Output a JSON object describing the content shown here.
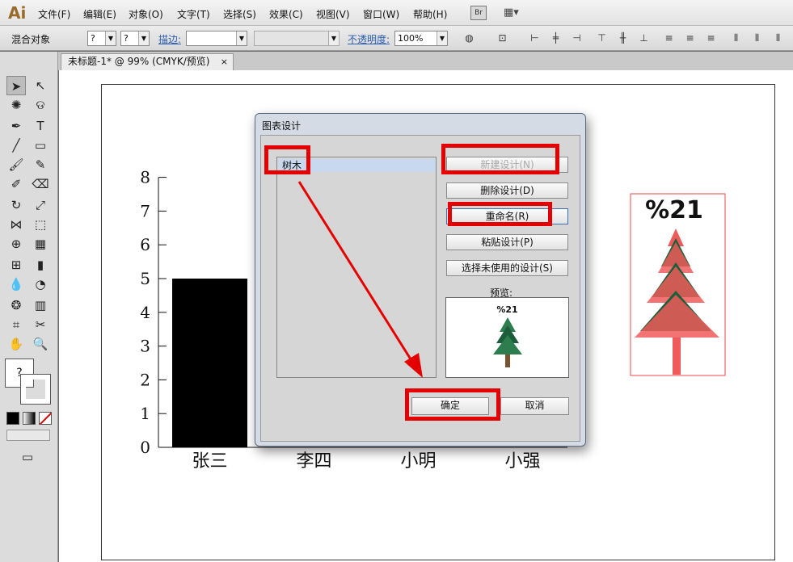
{
  "app": {
    "logo": "Ai"
  },
  "menubar": {
    "items": [
      "文件(F)",
      "编辑(E)",
      "对象(O)",
      "文字(T)",
      "选择(S)",
      "效果(C)",
      "视图(V)",
      "窗口(W)",
      "帮助(H)"
    ],
    "bridge_label": "Br"
  },
  "control_bar": {
    "selection_label": "混合对象",
    "fill_value": "?",
    "stroke_value": "?",
    "stroke_link": "描边:",
    "opacity_link": "不透明度:",
    "opacity_value": "100%"
  },
  "document_tab": {
    "title": "未标题-1* @ 99% (CMYK/预览)",
    "close_symbol": "×"
  },
  "toolbox": {
    "fill_stroke_question": "?"
  },
  "colors": {
    "highlight": "#e50000",
    "tree_pink": "#ef5a5a",
    "tree_dark": "#1d5e3a",
    "tree_green": "#2e7d4f",
    "trunk": "#7a5230"
  },
  "chart_data": {
    "type": "bar",
    "categories": [
      "张三",
      "李四",
      "小明",
      "小强"
    ],
    "values": [
      5,
      null,
      null,
      null
    ],
    "ylim": [
      0,
      8
    ],
    "yticks": [
      "0",
      "1",
      "2",
      "3",
      "4",
      "5",
      "6",
      "7",
      "8"
    ]
  },
  "artboard_object": {
    "label": "%21"
  },
  "dialog": {
    "title": "图表设计",
    "list_items": [
      "树木"
    ],
    "buttons": {
      "new": "新建设计(N)",
      "delete": "删除设计(D)",
      "rename": "重命名(R)",
      "paste": "粘贴设计(P)",
      "select_unused": "选择未使用的设计(S)",
      "ok": "确定",
      "cancel": "取消"
    },
    "preview_label": "预览:",
    "preview_text": "%21"
  }
}
